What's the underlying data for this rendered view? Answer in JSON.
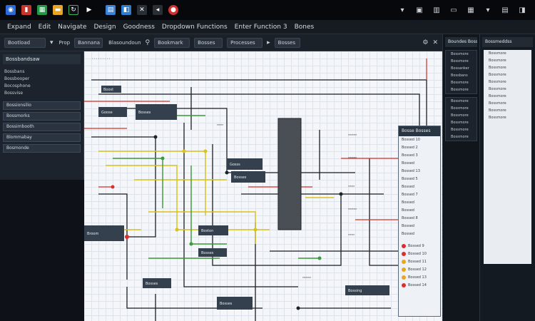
{
  "taskbar": {
    "icons": [
      "chrome-icon",
      "bookmark-icon",
      "sheet-icon",
      "folder-icon",
      "refresh-icon",
      "play-icon",
      "docs-icon",
      "image-icon",
      "tools-icon",
      "mail-icon",
      "media-icon"
    ],
    "tray_icons": [
      "window-icon",
      "calendar-icon",
      "settings-icon",
      "battery-icon",
      "network-icon",
      "clock-icon",
      "volume-icon",
      "power-icon"
    ]
  },
  "menubar": {
    "items": [
      "Expand",
      "Edit",
      "Navigate",
      "Design",
      "Goodness",
      "Dropdown Functions",
      "Enter Function 3",
      "Bones"
    ]
  },
  "toolbar": {
    "field1": "Bootload",
    "label1": "Prop",
    "field2": "Bannana",
    "label2": "Blasoundoun",
    "field3": "Bookmark",
    "field4": "Bosses",
    "field5": "Processes",
    "field6": "Bosses"
  },
  "left_panel": {
    "header": "Bossbandsaw",
    "items": [
      "Bossbans",
      "Bossbooper",
      "Bocosphone",
      "Bossvise"
    ],
    "fields": [
      "Bossionsilio",
      "Bossmorks",
      "Bossimbooth",
      "Blommabay",
      "Bosmonde"
    ]
  },
  "canvas": {
    "chips": [
      "Boost",
      "Goose",
      "Bosses",
      "Gosss",
      "Bosses",
      "Broom",
      "Boston",
      "Bosses",
      "Bosses",
      "Bosses",
      "Bossing"
    ]
  },
  "prop_panel": {
    "header": "Bosse Bosses",
    "rows": [
      "Bossed 10",
      "Bossed 2",
      "Bossed 3",
      "Bossed",
      "Bossed 13",
      "Bossed 5",
      "Bossed",
      "Bossed 7",
      "Bossed",
      "Bossed",
      "Bossed 8",
      "Bossed",
      "Bossed"
    ],
    "status_rows": [
      "Bossed 9",
      "Bossed 10",
      "Bossed 11",
      "Bossed 12",
      "Bossed 13",
      "Bossed 14"
    ],
    "status_colors": [
      "#d9302f",
      "#d9302f",
      "#e7a621",
      "#e7a621",
      "#e7a621",
      "#d9302f"
    ]
  },
  "sidebar1": {
    "header": "Boundes Bosses",
    "items": [
      "Bossmore",
      "Bossmore",
      "Bossanker",
      "Bossbans",
      "Bossmore",
      "Bossmore",
      "Bossmore",
      "Bossmore",
      "Bossmore",
      "Bossmore",
      "Bossmore",
      "Bossmore"
    ]
  },
  "sidebar2": {
    "header": "Bossmeddss",
    "items": [
      "Bossmore",
      "Bossmore",
      "Bossmore",
      "Bossmore",
      "Bossmore",
      "Bossmore",
      "Bossmore",
      "Bossmore",
      "Bossmore",
      "Bossmore"
    ]
  },
  "colors": {
    "wire_dark": "#1c2229",
    "wire_yellow": "#d9c21b",
    "wire_green": "#3c9a3a",
    "wire_red": "#d8312c",
    "chip": "#34404d"
  }
}
